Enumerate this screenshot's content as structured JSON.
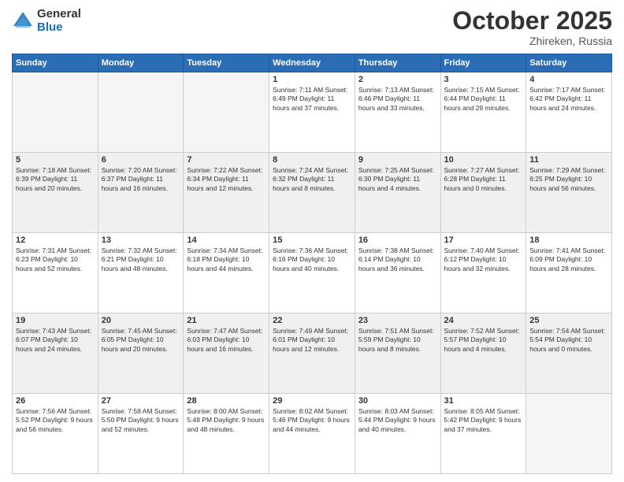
{
  "header": {
    "logo_general": "General",
    "logo_blue": "Blue",
    "month": "October 2025",
    "location": "Zhireken, Russia"
  },
  "days_of_week": [
    "Sunday",
    "Monday",
    "Tuesday",
    "Wednesday",
    "Thursday",
    "Friday",
    "Saturday"
  ],
  "weeks": [
    [
      {
        "day": "",
        "info": ""
      },
      {
        "day": "",
        "info": ""
      },
      {
        "day": "",
        "info": ""
      },
      {
        "day": "1",
        "info": "Sunrise: 7:11 AM\nSunset: 6:49 PM\nDaylight: 11 hours\nand 37 minutes."
      },
      {
        "day": "2",
        "info": "Sunrise: 7:13 AM\nSunset: 6:46 PM\nDaylight: 11 hours\nand 33 minutes."
      },
      {
        "day": "3",
        "info": "Sunrise: 7:15 AM\nSunset: 6:44 PM\nDaylight: 11 hours\nand 29 minutes."
      },
      {
        "day": "4",
        "info": "Sunrise: 7:17 AM\nSunset: 6:42 PM\nDaylight: 11 hours\nand 24 minutes."
      }
    ],
    [
      {
        "day": "5",
        "info": "Sunrise: 7:18 AM\nSunset: 6:39 PM\nDaylight: 11 hours\nand 20 minutes."
      },
      {
        "day": "6",
        "info": "Sunrise: 7:20 AM\nSunset: 6:37 PM\nDaylight: 11 hours\nand 16 minutes."
      },
      {
        "day": "7",
        "info": "Sunrise: 7:22 AM\nSunset: 6:34 PM\nDaylight: 11 hours\nand 12 minutes."
      },
      {
        "day": "8",
        "info": "Sunrise: 7:24 AM\nSunset: 6:32 PM\nDaylight: 11 hours\nand 8 minutes."
      },
      {
        "day": "9",
        "info": "Sunrise: 7:25 AM\nSunset: 6:30 PM\nDaylight: 11 hours\nand 4 minutes."
      },
      {
        "day": "10",
        "info": "Sunrise: 7:27 AM\nSunset: 6:28 PM\nDaylight: 11 hours\nand 0 minutes."
      },
      {
        "day": "11",
        "info": "Sunrise: 7:29 AM\nSunset: 6:25 PM\nDaylight: 10 hours\nand 56 minutes."
      }
    ],
    [
      {
        "day": "12",
        "info": "Sunrise: 7:31 AM\nSunset: 6:23 PM\nDaylight: 10 hours\nand 52 minutes."
      },
      {
        "day": "13",
        "info": "Sunrise: 7:32 AM\nSunset: 6:21 PM\nDaylight: 10 hours\nand 48 minutes."
      },
      {
        "day": "14",
        "info": "Sunrise: 7:34 AM\nSunset: 6:18 PM\nDaylight: 10 hours\nand 44 minutes."
      },
      {
        "day": "15",
        "info": "Sunrise: 7:36 AM\nSunset: 6:16 PM\nDaylight: 10 hours\nand 40 minutes."
      },
      {
        "day": "16",
        "info": "Sunrise: 7:38 AM\nSunset: 6:14 PM\nDaylight: 10 hours\nand 36 minutes."
      },
      {
        "day": "17",
        "info": "Sunrise: 7:40 AM\nSunset: 6:12 PM\nDaylight: 10 hours\nand 32 minutes."
      },
      {
        "day": "18",
        "info": "Sunrise: 7:41 AM\nSunset: 6:09 PM\nDaylight: 10 hours\nand 28 minutes."
      }
    ],
    [
      {
        "day": "19",
        "info": "Sunrise: 7:43 AM\nSunset: 6:07 PM\nDaylight: 10 hours\nand 24 minutes."
      },
      {
        "day": "20",
        "info": "Sunrise: 7:45 AM\nSunset: 6:05 PM\nDaylight: 10 hours\nand 20 minutes."
      },
      {
        "day": "21",
        "info": "Sunrise: 7:47 AM\nSunset: 6:03 PM\nDaylight: 10 hours\nand 16 minutes."
      },
      {
        "day": "22",
        "info": "Sunrise: 7:49 AM\nSunset: 6:01 PM\nDaylight: 10 hours\nand 12 minutes."
      },
      {
        "day": "23",
        "info": "Sunrise: 7:51 AM\nSunset: 5:59 PM\nDaylight: 10 hours\nand 8 minutes."
      },
      {
        "day": "24",
        "info": "Sunrise: 7:52 AM\nSunset: 5:57 PM\nDaylight: 10 hours\nand 4 minutes."
      },
      {
        "day": "25",
        "info": "Sunrise: 7:54 AM\nSunset: 5:54 PM\nDaylight: 10 hours\nand 0 minutes."
      }
    ],
    [
      {
        "day": "26",
        "info": "Sunrise: 7:56 AM\nSunset: 5:52 PM\nDaylight: 9 hours\nand 56 minutes."
      },
      {
        "day": "27",
        "info": "Sunrise: 7:58 AM\nSunset: 5:50 PM\nDaylight: 9 hours\nand 52 minutes."
      },
      {
        "day": "28",
        "info": "Sunrise: 8:00 AM\nSunset: 5:48 PM\nDaylight: 9 hours\nand 48 minutes."
      },
      {
        "day": "29",
        "info": "Sunrise: 8:02 AM\nSunset: 5:46 PM\nDaylight: 9 hours\nand 44 minutes."
      },
      {
        "day": "30",
        "info": "Sunrise: 8:03 AM\nSunset: 5:44 PM\nDaylight: 9 hours\nand 40 minutes."
      },
      {
        "day": "31",
        "info": "Sunrise: 8:05 AM\nSunset: 5:42 PM\nDaylight: 9 hours\nand 37 minutes."
      },
      {
        "day": "",
        "info": ""
      }
    ]
  ]
}
